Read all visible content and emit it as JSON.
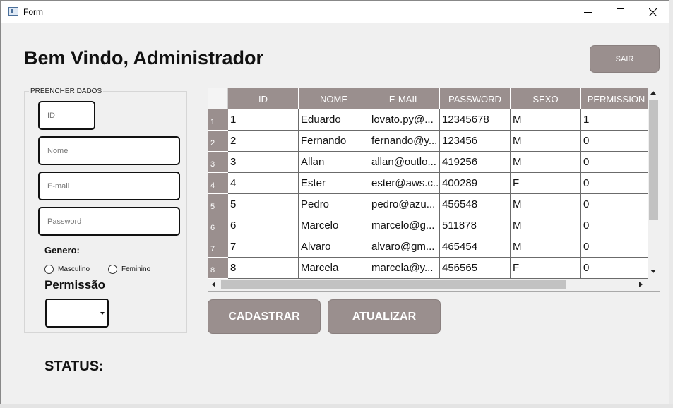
{
  "window": {
    "title": "Form",
    "minimize_icon": "minimize-icon",
    "maximize_icon": "maximize-icon",
    "close_icon": "close-icon"
  },
  "header": {
    "welcome": "Bem Vindo, Administrador",
    "logout_label": "SAIR"
  },
  "form": {
    "group_title": "PREENCHER DADOS",
    "id_placeholder": "ID",
    "nome_placeholder": "Nome",
    "email_placeholder": "E-mail",
    "password_placeholder": "Password",
    "genero_label": "Genero:",
    "masculino_label": "Masculino",
    "feminino_label": "Feminino",
    "permissao_label": "Permissão",
    "permissao_value": ""
  },
  "table": {
    "columns": [
      "ID",
      "NOME",
      "E-MAIL",
      "PASSWORD",
      "SEXO",
      "PERMISSION"
    ],
    "rows": [
      {
        "num": "1",
        "cells": [
          "1",
          "Eduardo",
          "lovato.py@...",
          "12345678",
          "M",
          "1"
        ]
      },
      {
        "num": "2",
        "cells": [
          "2",
          "Fernando",
          "fernando@y...",
          "123456",
          "M",
          "0"
        ]
      },
      {
        "num": "3",
        "cells": [
          "3",
          "Allan",
          "allan@outlo...",
          "419256",
          "M",
          "0"
        ]
      },
      {
        "num": "4",
        "cells": [
          "4",
          "Ester",
          "ester@aws.c...",
          "400289",
          "F",
          "0"
        ]
      },
      {
        "num": "5",
        "cells": [
          "5",
          "Pedro",
          "pedro@azu...",
          "456548",
          "M",
          "0"
        ]
      },
      {
        "num": "6",
        "cells": [
          "6",
          "Marcelo",
          "marcelo@g...",
          "511878",
          "M",
          "0"
        ]
      },
      {
        "num": "7",
        "cells": [
          "7",
          "Alvaro",
          "alvaro@gm...",
          "465454",
          "M",
          "0"
        ]
      },
      {
        "num": "8",
        "cells": [
          "8",
          "Marcela",
          "marcela@y...",
          "456565",
          "F",
          "0"
        ]
      }
    ]
  },
  "actions": {
    "cadastrar_label": "CADASTRAR",
    "atualizar_label": "ATUALIZAR"
  },
  "status": {
    "label": "STATUS:"
  },
  "colors": {
    "accent": "#9a8f8e",
    "background": "#f0f0f0"
  }
}
